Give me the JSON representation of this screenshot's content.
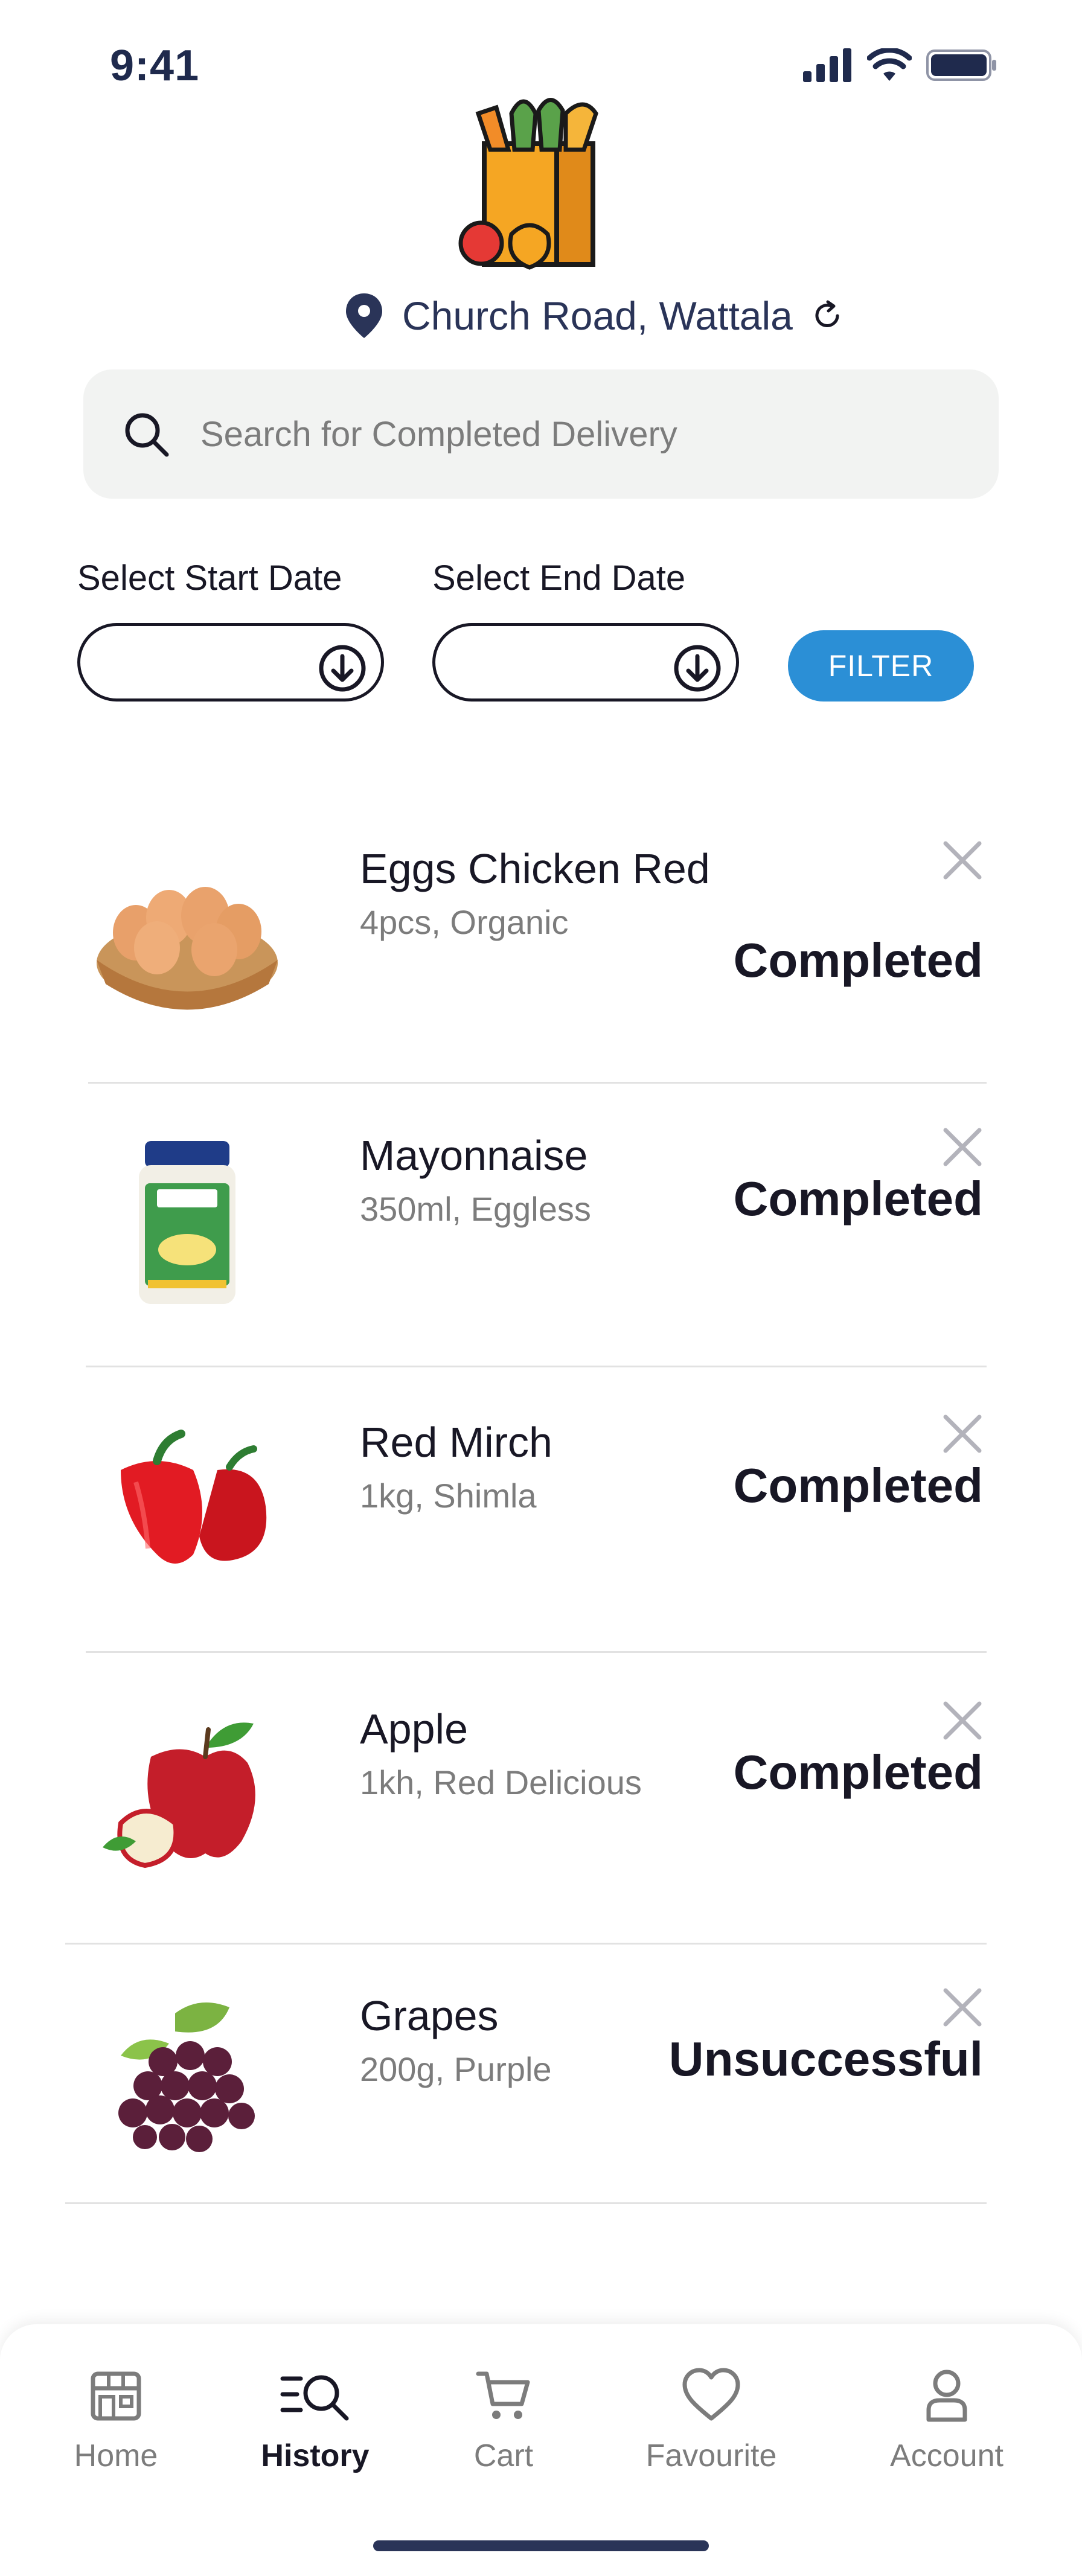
{
  "status_bar": {
    "time": "9:41"
  },
  "location": {
    "text": "Church Road, Wattala"
  },
  "search": {
    "placeholder": "Search for Completed Delivery"
  },
  "filters": {
    "start_label": "Select Start Date",
    "end_label": "Select End Date",
    "start_value": "",
    "end_value": "",
    "filter_button": "FILTER"
  },
  "items": [
    {
      "name": "Eggs Chicken Red",
      "desc": "4pcs, Organic",
      "status": "Completed",
      "image": "eggs-basket"
    },
    {
      "name": "Mayonnaise",
      "desc": "350ml, Eggless",
      "status": "Completed",
      "image": "mayonnaise-jar"
    },
    {
      "name": "Red Mirch",
      "desc": "1kg, Shimla",
      "status": "Completed",
      "image": "red-bell-pepper"
    },
    {
      "name": "Apple",
      "desc": "1kh, Red Delicious",
      "status": "Completed",
      "image": "red-apple"
    },
    {
      "name": "Grapes",
      "desc": "200g, Purple",
      "status": "Unsuccessful",
      "image": "purple-grapes"
    }
  ],
  "nav": [
    {
      "label": "Home",
      "icon": "store-icon",
      "active": false
    },
    {
      "label": "History",
      "icon": "history-search-icon",
      "active": true
    },
    {
      "label": "Cart",
      "icon": "cart-icon",
      "active": false
    },
    {
      "label": "Favourite",
      "icon": "heart-icon",
      "active": false
    },
    {
      "label": "Account",
      "icon": "user-icon",
      "active": false
    }
  ],
  "colors": {
    "accent": "#2b8fd6",
    "text": "#181725",
    "muted": "#7c7c7c",
    "navy": "#2a3458"
  }
}
